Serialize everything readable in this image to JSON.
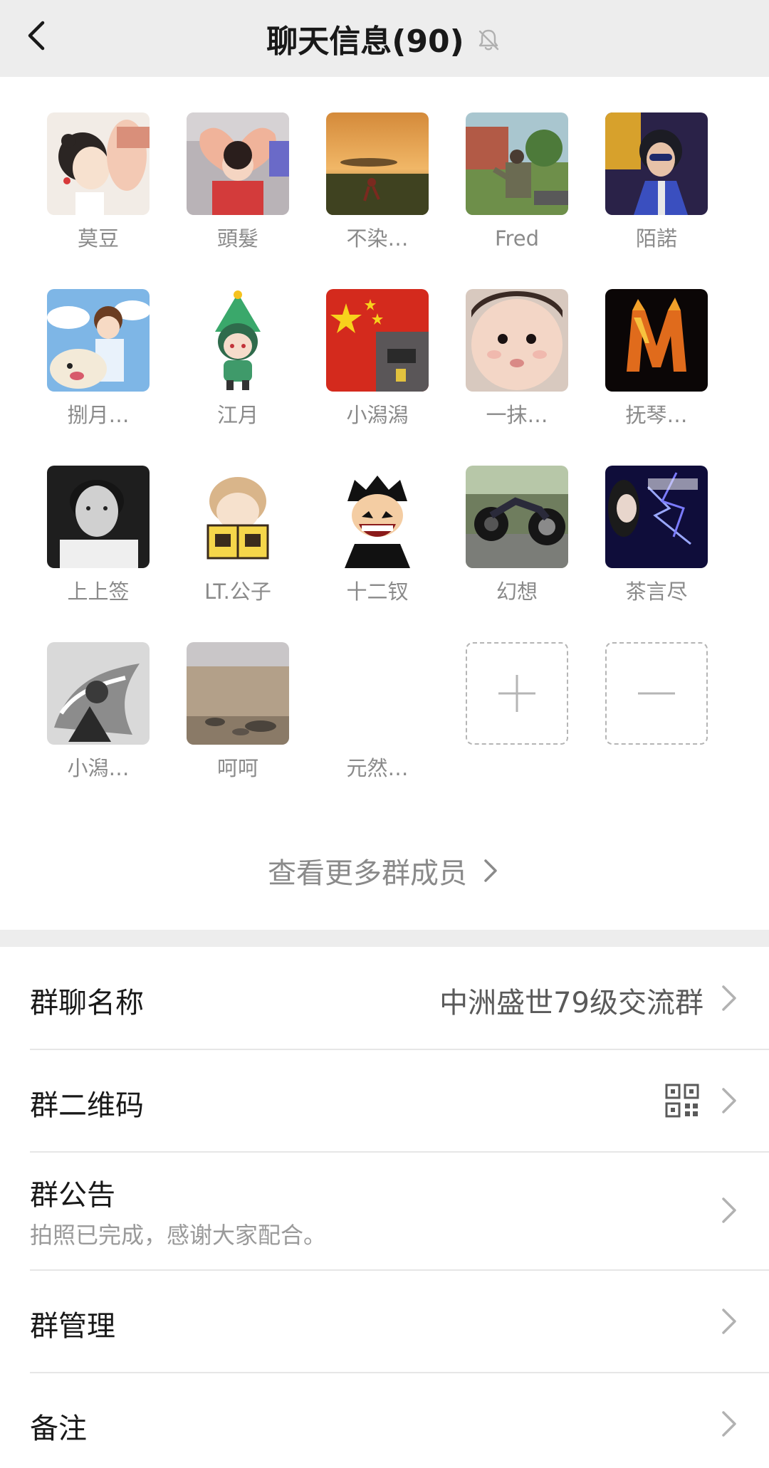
{
  "header": {
    "title": "聊天信息(90)",
    "back_icon": "chevron-left-icon",
    "mute_icon": "bell-off-icon"
  },
  "members": [
    {
      "name": "莫豆"
    },
    {
      "name": "頭髮"
    },
    {
      "name": "不染…"
    },
    {
      "name": "Fred"
    },
    {
      "name": "陌諾"
    },
    {
      "name": "捌月…"
    },
    {
      "name": "江月"
    },
    {
      "name": "小潟潟"
    },
    {
      "name": "一抹…"
    },
    {
      "name": "抚琴…"
    },
    {
      "name": "上上签"
    },
    {
      "name": "LT.公子"
    },
    {
      "name": "十二钗"
    },
    {
      "name": "幻想"
    },
    {
      "name": "茶言尽"
    },
    {
      "name": "小潟…"
    },
    {
      "name": "呵呵"
    },
    {
      "name": "元然…"
    }
  ],
  "member_actions": {
    "add_icon": "plus-icon",
    "remove_icon": "minus-icon"
  },
  "more_members": {
    "label": "查看更多群成员"
  },
  "settings": {
    "group_name": {
      "label": "群聊名称",
      "value": "中洲盛世79级交流群"
    },
    "qr_code": {
      "label": "群二维码",
      "icon": "qr-code-icon"
    },
    "announcement": {
      "label": "群公告",
      "content": "拍照已完成，感谢大家配合。"
    },
    "manage": {
      "label": "群管理"
    },
    "remark": {
      "label": "备注"
    }
  },
  "colors": {
    "navbar_bg": "#ededed",
    "separator_bg": "#ededed",
    "secondary_text": "#8a8a8a"
  }
}
